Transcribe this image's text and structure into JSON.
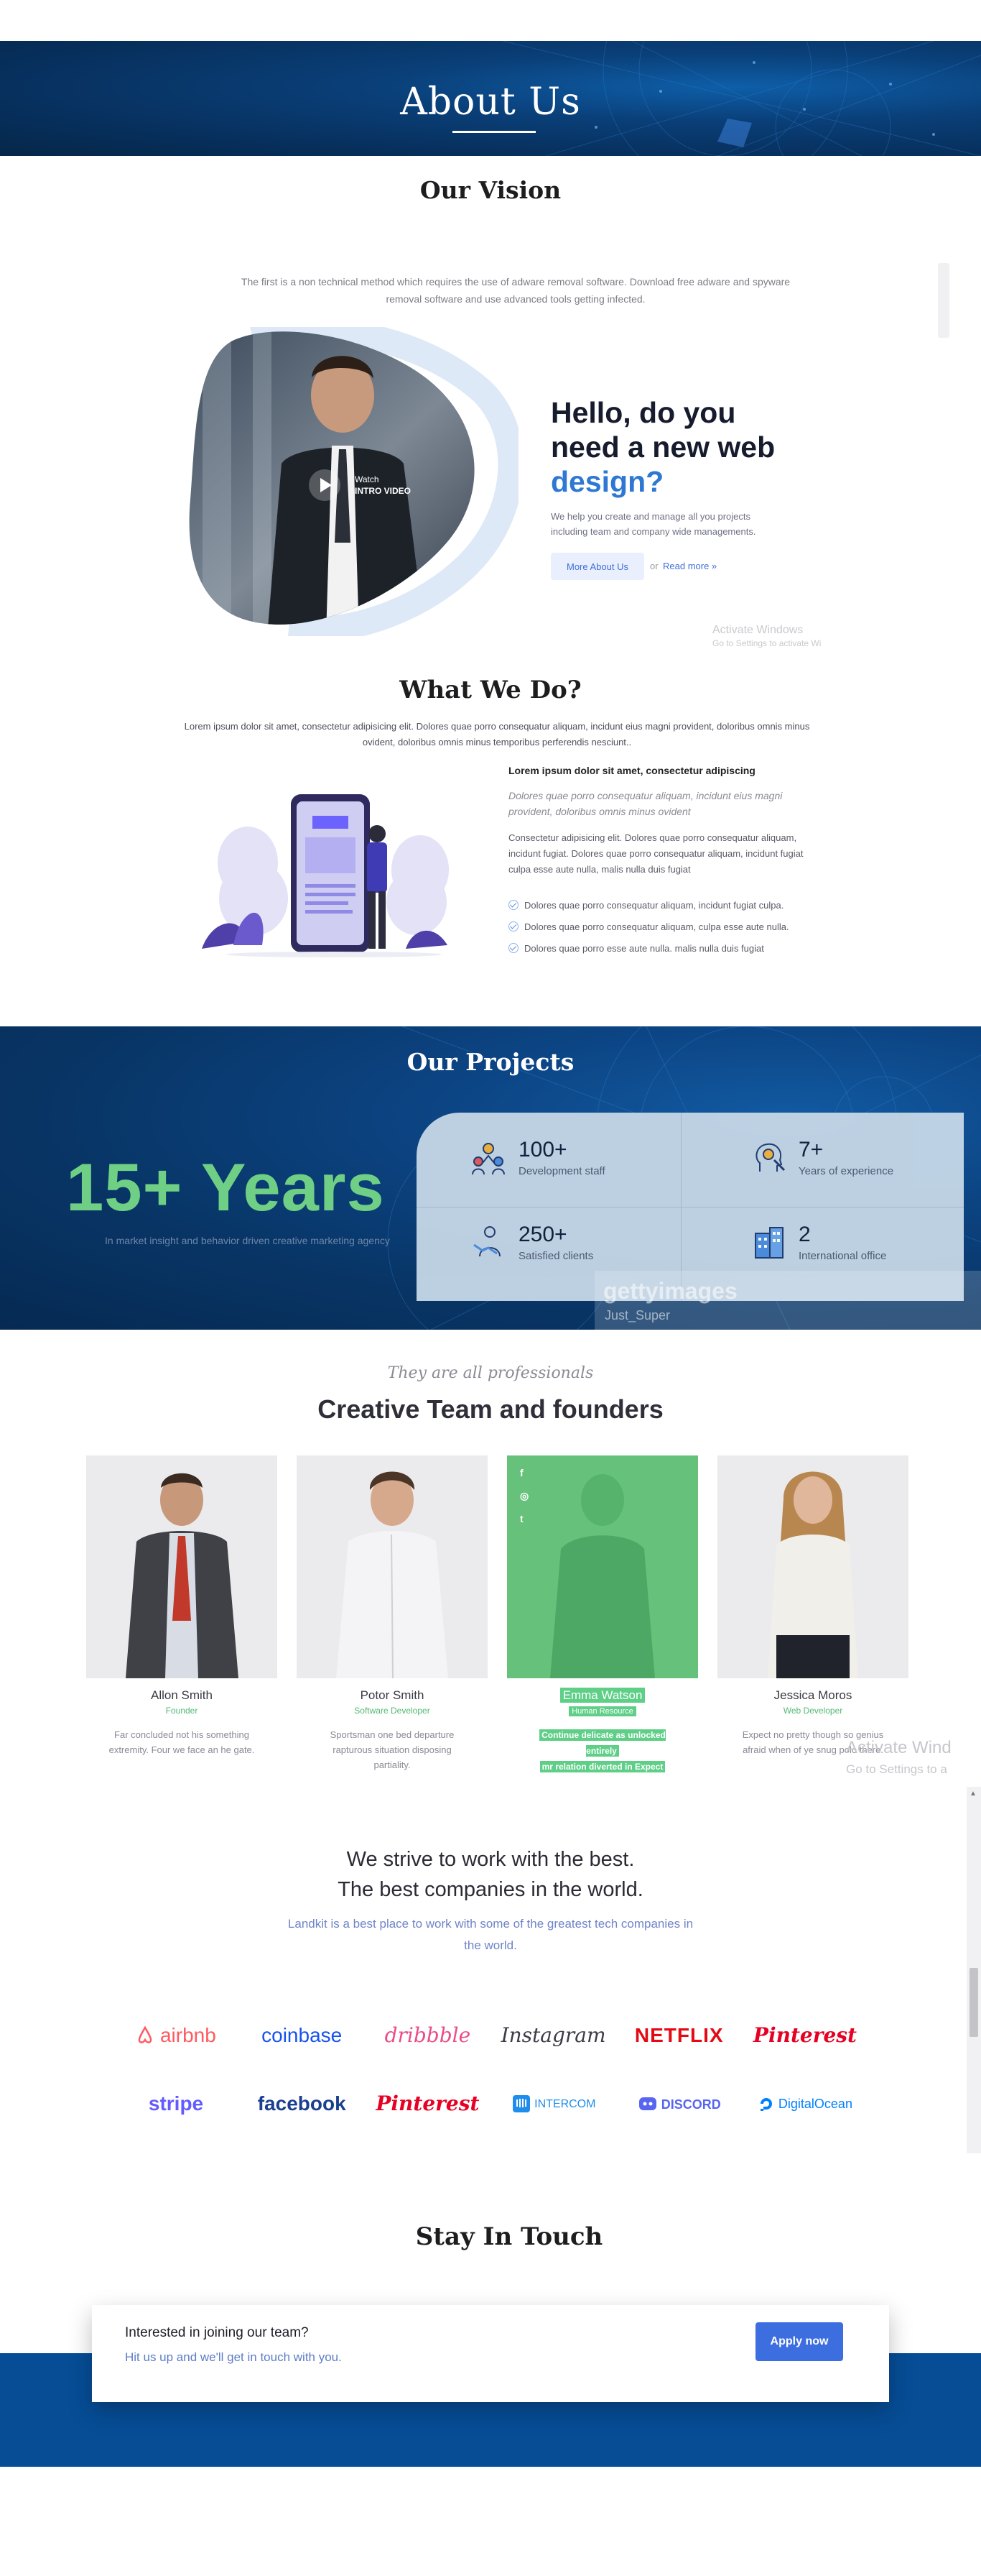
{
  "hero": {
    "title": "About Us"
  },
  "vision": {
    "title": "Our Vision",
    "description": "The first is a non technical method which requires the use of adware removal software. Download free adware and spyware removal software and use advanced tools getting infected.",
    "video_label_1": "Watch",
    "video_label_2": "INTRO VIDEO",
    "hello_line1": "Hello, do you",
    "hello_line2": "need a new web",
    "hello_accent": "design?",
    "hello_desc": "We help you create and manage all you projects including team and company wide managements.",
    "more_button": "More About Us",
    "or": "or",
    "read_more": "Read more »",
    "activate_title": "Activate Windows",
    "activate_sub": "Go to Settings to activate Wi"
  },
  "what_we_do": {
    "title": "What We Do?",
    "description": "Lorem ipsum dolor sit amet, consectetur adipisicing elit. Dolores quae porro consequatur aliquam, incidunt eius magni provident, doloribus omnis minus ovident, doloribus omnis minus temporibus perferendis nesciunt..",
    "heading": "Lorem ipsum dolor sit amet, consectetur adipiscing",
    "italic": "Dolores quae porro consequatur aliquam, incidunt eius magni provident, doloribus omnis minus ovident",
    "paragraph": "Consectetur adipisicing elit. Dolores quae porro consequatur aliquam, incidunt fugiat. Dolores quae porro consequatur aliquam, incidunt fugiat culpa esse aute nulla, malis nulla duis fugiat",
    "list": [
      "Dolores quae porro consequatur aliquam, incidunt fugiat culpa.",
      "Dolores quae porro consequatur aliquam, culpa esse aute nulla.",
      "Dolores quae porro esse aute nulla. malis nulla duis fugiat"
    ]
  },
  "projects": {
    "title": "Our Projects",
    "years": "15+ Years",
    "years_sub": "In market insight and behavior driven creative marketing agency",
    "stats": [
      {
        "icon": "team-icon",
        "value": "100+",
        "label": "Development staff"
      },
      {
        "icon": "idea-head-icon",
        "value": "7+",
        "label": "Years of experience"
      },
      {
        "icon": "handshake-person-icon",
        "value": "250+",
        "label": "Satisfied clients"
      },
      {
        "icon": "office-building-icon",
        "value": "2",
        "label": "International office"
      }
    ],
    "getty_1": "gettyimages",
    "getty_2": "Just_Super"
  },
  "team": {
    "kicker": "They are all professionals",
    "title": "Creative Team and founders",
    "members": [
      {
        "name": "Allon Smith",
        "role": "Founder",
        "bio": "Far concluded not his something extremity. Four we face an he gate."
      },
      {
        "name": "Potor Smith",
        "role": "Software Developer",
        "bio": "Sportsman one bed departure rapturous situation disposing partiality."
      },
      {
        "name": "Emma Watson",
        "role": "Human Resource",
        "bio_1": "Continue delicate as unlocked entirely",
        "bio_2": "mr relation diverted in Expect"
      },
      {
        "name": "Jessica Moros",
        "role": "Web Developer",
        "bio": "Expect no pretty though so genius afraid when of ye snug polo there."
      }
    ],
    "social": [
      "f",
      "◎",
      "t"
    ],
    "activate_title": "Activate Wind",
    "activate_sub": "Go to Settings to a"
  },
  "companies": {
    "line1": "We strive to work with the best.",
    "line2": "The best companies in the world.",
    "sub": "Landkit is a best place to work with some of the greatest tech companies in the world.",
    "row1": [
      {
        "name": "airbnb",
        "color": "#ff5a5f"
      },
      {
        "name": "coinbase",
        "color": "#1652f0"
      },
      {
        "name": "dribbble",
        "color": "#ea4c89"
      },
      {
        "name": "Instagram",
        "color": "#3c3c4a"
      },
      {
        "name": "NETFLIX",
        "color": "#e50914"
      },
      {
        "name": "Pinterest",
        "color": "#e60023"
      }
    ],
    "row2": [
      {
        "name": "stripe",
        "color": "#635bff"
      },
      {
        "name": "facebook",
        "color": "#1a3f8f"
      },
      {
        "name": "Pinterest",
        "color": "#e60023"
      },
      {
        "name": "INTERCOM",
        "color": "#1f8ded"
      },
      {
        "name": "DISCORD",
        "color": "#5865f2"
      },
      {
        "name": "DigitalOcean",
        "color": "#0080ff"
      }
    ]
  },
  "touch": {
    "title": "Stay In Touch",
    "question": "Interested in joining our team?",
    "sub": "Hit us up and we'll get in touch with you.",
    "button": "Apply now"
  }
}
